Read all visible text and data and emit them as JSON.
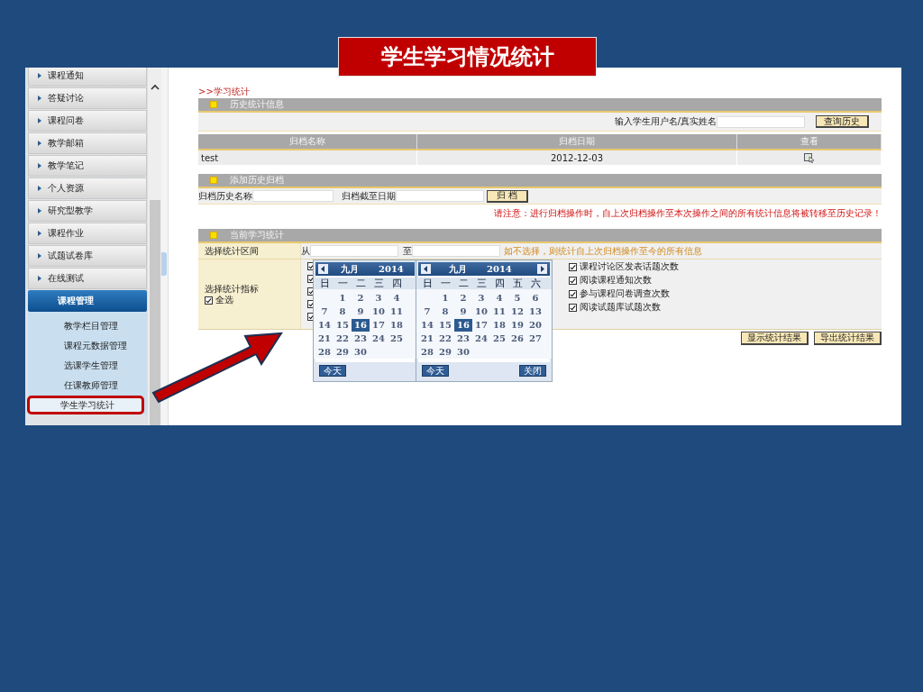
{
  "slide": {
    "title": "学生学习情况统计"
  },
  "sidebar": {
    "items": [
      {
        "label": "课程通知",
        "kind": "menu"
      },
      {
        "label": "答疑讨论",
        "kind": "menu"
      },
      {
        "label": "课程问卷",
        "kind": "menu"
      },
      {
        "label": "教学邮箱",
        "kind": "menu"
      },
      {
        "label": "教学笔记",
        "kind": "menu"
      },
      {
        "label": "个人资源",
        "kind": "menu"
      },
      {
        "label": "研究型教学",
        "kind": "menu"
      },
      {
        "label": "课程作业",
        "kind": "menu"
      },
      {
        "label": "试题试卷库",
        "kind": "menu"
      },
      {
        "label": "在线测试",
        "kind": "menu"
      },
      {
        "label": "课程管理",
        "kind": "group",
        "children": [
          {
            "label": "教学栏目管理",
            "selected": false
          },
          {
            "label": "课程元数据管理",
            "selected": false
          },
          {
            "label": "选课学生管理",
            "selected": false
          },
          {
            "label": "任课教师管理",
            "selected": false
          },
          {
            "label": "学生学习统计",
            "selected": true
          }
        ]
      }
    ]
  },
  "breadcrumb": ">>学习统计",
  "history": {
    "title": "历史统计信息",
    "search_label": "输入学生用户名/真实姓名",
    "search_button": "查询历史",
    "columns": [
      "归档名称",
      "归档日期",
      "查看"
    ],
    "rows": [
      {
        "name": "test",
        "date": "2012-12-03"
      }
    ]
  },
  "archive": {
    "title": "添加历史归档",
    "name_label": "归档历史名称",
    "date_label": "归档截至日期",
    "button": "归 档",
    "note": "请注意：进行归档操作时，自上次归档操作至本次操作之间的所有统计信息将被转移至历史记录！"
  },
  "current": {
    "title": "当前学习统计",
    "range_label": "选择统计区间",
    "from_label": "从",
    "to_label": "至",
    "range_hint": "如不选择，则统计自上次归档操作至今的所有信息",
    "indicator_label": "选择统计指标",
    "select_all": {
      "label": "全选",
      "checked": true
    },
    "covered_indicators": [
      {
        "checked": true
      },
      {
        "checked": true
      },
      {
        "checked": true
      },
      {
        "checked": true
      },
      {
        "checked": true
      }
    ],
    "indicators": [
      {
        "label": "课程讨论区发表话题次数",
        "checked": true
      },
      {
        "label": "阅读课程通知次数",
        "checked": true
      },
      {
        "label": "参与课程问卷调查次数",
        "checked": true
      },
      {
        "label": "阅读试题库试题次数",
        "checked": true
      }
    ],
    "buttons": [
      "显示统计结果",
      "导出统计结果"
    ]
  },
  "calendars": [
    {
      "month": "九月",
      "year": "2014",
      "prev_button": true,
      "next_button": false,
      "weekdays": [
        "日",
        "一",
        "二",
        "三",
        "四"
      ],
      "first_week_indented": true,
      "weeks": [
        [
          {
            "day": "1",
            "selected": false
          },
          {
            "day": "2",
            "selected": false
          },
          {
            "day": "3",
            "selected": false
          },
          {
            "day": "4",
            "selected": false
          }
        ],
        [
          {
            "day": "7",
            "selected": false
          },
          {
            "day": "8",
            "selected": false
          },
          {
            "day": "9",
            "selected": false
          },
          {
            "day": "10",
            "selected": false
          },
          {
            "day": "11",
            "selected": false
          }
        ],
        [
          {
            "day": "14",
            "selected": false
          },
          {
            "day": "15",
            "selected": false
          },
          {
            "day": "16",
            "selected": true
          },
          {
            "day": "17",
            "selected": false
          },
          {
            "day": "18",
            "selected": false
          }
        ],
        [
          {
            "day": "21",
            "selected": false
          },
          {
            "day": "22",
            "selected": false
          },
          {
            "day": "23",
            "selected": false
          },
          {
            "day": "24",
            "selected": false
          },
          {
            "day": "25",
            "selected": false
          }
        ],
        [
          {
            "day": "28",
            "selected": false
          },
          {
            "day": "29",
            "selected": false
          },
          {
            "day": "30",
            "selected": false
          }
        ]
      ],
      "buttons": [
        "今天"
      ]
    },
    {
      "month": "九月",
      "year": "2014",
      "prev_button": true,
      "next_button": true,
      "weekdays": [
        "日",
        "一",
        "二",
        "三",
        "四",
        "五",
        "六"
      ],
      "first_week_indented": true,
      "weeks": [
        [
          {
            "day": "1",
            "selected": false
          },
          {
            "day": "2",
            "selected": false
          },
          {
            "day": "3",
            "selected": false
          },
          {
            "day": "4",
            "selected": false
          },
          {
            "day": "5",
            "selected": false
          },
          {
            "day": "6",
            "selected": false
          }
        ],
        [
          {
            "day": "7",
            "selected": false
          },
          {
            "day": "8",
            "selected": false
          },
          {
            "day": "9",
            "selected": false
          },
          {
            "day": "10",
            "selected": false
          },
          {
            "day": "11",
            "selected": false
          },
          {
            "day": "12",
            "selected": false
          },
          {
            "day": "13",
            "selected": false
          }
        ],
        [
          {
            "day": "14",
            "selected": false
          },
          {
            "day": "15",
            "selected": false
          },
          {
            "day": "16",
            "selected": true
          },
          {
            "day": "17",
            "selected": false
          },
          {
            "day": "18",
            "selected": false
          },
          {
            "day": "19",
            "selected": false
          },
          {
            "day": "20",
            "selected": false
          }
        ],
        [
          {
            "day": "21",
            "selected": false
          },
          {
            "day": "22",
            "selected": false
          },
          {
            "day": "23",
            "selected": false
          },
          {
            "day": "24",
            "selected": false
          },
          {
            "day": "25",
            "selected": false
          },
          {
            "day": "26",
            "selected": false
          },
          {
            "day": "27",
            "selected": false
          }
        ],
        [
          {
            "day": "28",
            "selected": false
          },
          {
            "day": "29",
            "selected": false
          },
          {
            "day": "30",
            "selected": false
          }
        ]
      ],
      "buttons": [
        "今天",
        "关闭"
      ]
    }
  ]
}
